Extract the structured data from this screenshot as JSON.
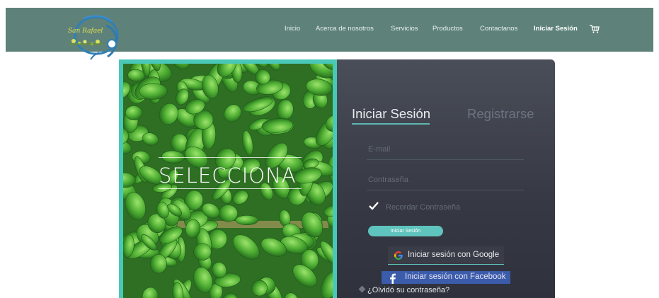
{
  "header": {
    "logo_text": "San Rafael",
    "nav": [
      {
        "label": "Inicio"
      },
      {
        "label": "Acerca de nosotros"
      },
      {
        "label": "Servicios"
      },
      {
        "label": "Productos"
      },
      {
        "label": "Contactanos"
      },
      {
        "label": "Iniciar Sesión",
        "active": true
      }
    ],
    "cart_icon": "shopping-cart-icon"
  },
  "promo": {
    "title": "SELECCIONA"
  },
  "login": {
    "tabs": [
      {
        "label": "Iniciar Sesión",
        "active": true
      },
      {
        "label": "Registrarse",
        "active": false
      }
    ],
    "email_placeholder": "E-mail",
    "password_placeholder": "Contraseña",
    "remember_label": "Recordar Contraseña",
    "remember_checked": true,
    "submit_label": "Iniciar Sesión",
    "google_label": "Iniciar sesión con Google",
    "facebook_label": "Iniciar sesión con Facebook",
    "forgot_label": "¿Olvidó su contraseña?"
  },
  "colors": {
    "header_bg": "#5e8279",
    "accent": "#5fc4bd",
    "panel_bg": "#3a3d47",
    "facebook": "#3b5bab",
    "image_border": "#49c8b8"
  }
}
